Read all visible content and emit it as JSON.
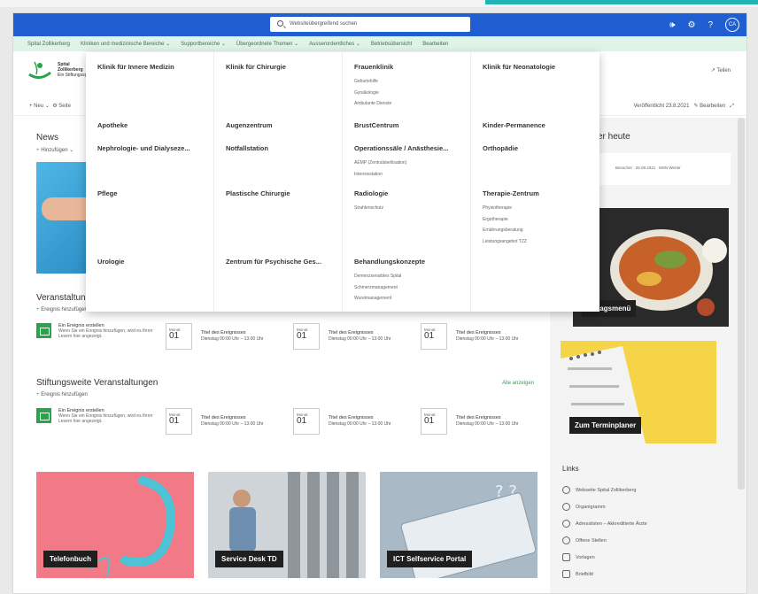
{
  "suitebar": {
    "search_placeholder": "Websiteübergreifend suchen",
    "avatar_initials": "CA",
    "icons": [
      "megaphone-icon",
      "gear-icon",
      "help-icon",
      "avatar"
    ]
  },
  "hubnav": {
    "items": [
      "Spital Zollikerberg",
      "Kliniken und medizinische Bereiche",
      "Supportbereiche",
      "Übergeordnete Themen",
      "Ausserordentliches",
      "Betriebsübersicht",
      "Bearbeiten"
    ]
  },
  "site": {
    "name_line1": "Spital Zollikerberg",
    "name_line2": "Ein Stiftungsspital",
    "share": "Teilen"
  },
  "cmdbar": {
    "new": "+ Neu",
    "page_details": "Seite",
    "published": "Veröffentlicht 23.8.2021",
    "edit": "Bearbeiten"
  },
  "news": {
    "title": "News",
    "add": "Hinzufügen"
  },
  "dropdown": {
    "columns": [
      [
        {
          "heading": "Klinik für Innere Medizin",
          "links": []
        },
        {
          "heading": "Apotheke",
          "links": []
        },
        {
          "heading": "Nephrologie- und Dialyseze...",
          "links": []
        },
        {
          "heading": "Pflege",
          "links": []
        },
        {
          "heading": "Urologie",
          "links": []
        }
      ],
      [
        {
          "heading": "Klinik für Chirurgie",
          "links": []
        },
        {
          "heading": "Augenzentrum",
          "links": []
        },
        {
          "heading": "Notfallstation",
          "links": []
        },
        {
          "heading": "Plastische Chirurgie",
          "links": []
        },
        {
          "heading": "Zentrum für Psychische Ges...",
          "links": []
        }
      ],
      [
        {
          "heading": "Frauenklinik",
          "links": [
            "Geburtshilfe",
            "Gynäkologie",
            "Ambulante Dienste"
          ]
        },
        {
          "heading": "BrustCentrum",
          "links": []
        },
        {
          "heading": "Operationssäle / Anästhesie...",
          "links": [
            "AEMP (Zentralsterilisation)",
            "Intensivstation"
          ]
        },
        {
          "heading": "Radiologie",
          "links": [
            "Strahlenschutz"
          ]
        },
        {
          "heading": "Behandlungskonzepte",
          "links": [
            "Demenzsensibles Spital",
            "Schmerzmanagement",
            "Wundmanagement"
          ]
        }
      ],
      [
        {
          "heading": "Klinik für Neonatologie",
          "links": []
        },
        {
          "heading": "Kinder-Permanence",
          "links": []
        },
        {
          "heading": "Orthopädie",
          "links": []
        },
        {
          "heading": "Therapie-Zentrum",
          "links": [
            "Physiotherapie",
            "Ergotherapie",
            "Ernährungsberatung",
            "Leistungsangebot TZZ"
          ]
        }
      ]
    ]
  },
  "events1": {
    "title": "Veranstaltungen",
    "add": "Ereignis hinzufügen"
  },
  "events2": {
    "title": "Stiftungsweite Veranstaltungen",
    "add": "Ereignis hinzufügen",
    "see_all": "Alle anzeigen"
  },
  "event_create": {
    "title": "Ein Ereignis erstellen",
    "desc": "Wenn Sie ein Ereignis hinzufügen, wird es Ihren Lesern hier angezeigt."
  },
  "event_placeholder": {
    "month": "Monat",
    "day": "01",
    "title": "Titel des Ereignisses",
    "time": "Dienstag 00:00 Uhr – 13:00 Uhr"
  },
  "cards": [
    {
      "label": "Telefonbuch"
    },
    {
      "label": "Service Desk TD"
    },
    {
      "label": "ICT Selfservice Portal"
    }
  ],
  "right": {
    "heute_title": "er heute",
    "besucher": "Besucher",
    "besucher_date": "25.08.2021",
    "besucher_name": "MSN Werter",
    "mittagsmenu": "Mittagsmenü",
    "terminplaner": "Zum Terminplaner"
  },
  "links": {
    "title": "Links",
    "items": [
      {
        "label": "Webseite Spital Zollikerberg",
        "icon": "globe-icon"
      },
      {
        "label": "Organigramm",
        "icon": "people-icon"
      },
      {
        "label": "Adresslisten – Akkreditierte Ärzte",
        "icon": "people-icon"
      },
      {
        "label": "Offene Stellen",
        "icon": "people-icon"
      },
      {
        "label": "Vorlagen",
        "icon": "document-icon"
      },
      {
        "label": "Briefbild",
        "icon": "document-icon"
      }
    ]
  },
  "colors": {
    "suitebar": "#1f5fd1",
    "hubnav": "#dff3e6",
    "accent_green": "#2ba24c",
    "teal": "#1fb3b3"
  }
}
